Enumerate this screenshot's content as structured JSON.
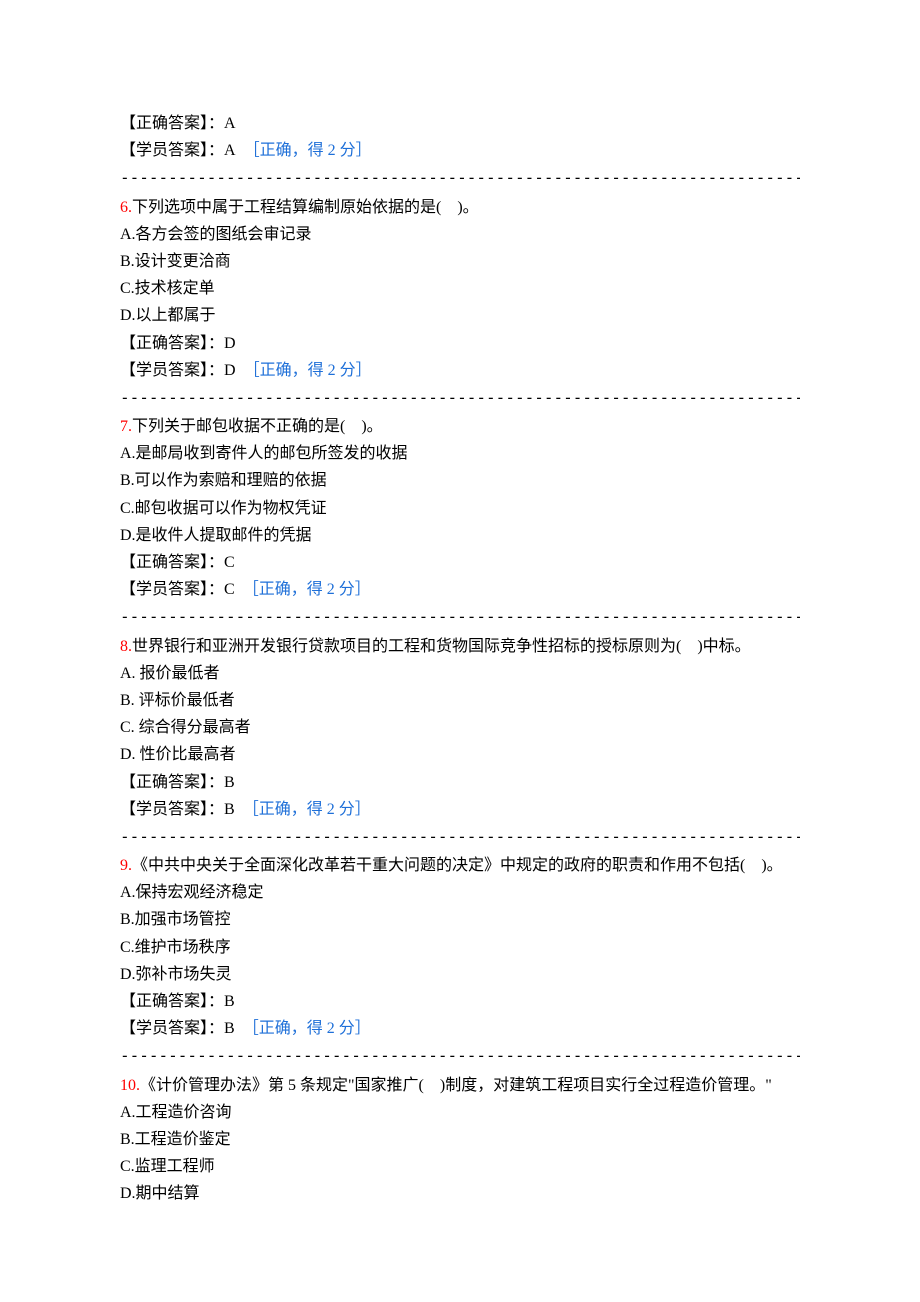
{
  "divider": "------------------------------------------------------------------------",
  "labels": {
    "correct_answer": "【正确答案】：",
    "student_answer": "【学员答案】：",
    "feedback_correct": "［正确，得 2 分］"
  },
  "partial_q5": {
    "correct_answer": "A",
    "student_answer": "A"
  },
  "questions": [
    {
      "number": "6.",
      "stem": "下列选项中属于工程结算编制原始依据的是(　)。",
      "options": [
        "A.各方会签的图纸会审记录",
        "B.设计变更洽商",
        "C.技术核定单",
        "D.以上都属于"
      ],
      "correct_answer": "D",
      "student_answer": "D",
      "show_feedback": true
    },
    {
      "number": "7.",
      "stem": "下列关于邮包收据不正确的是(　)。",
      "options": [
        "A.是邮局收到寄件人的邮包所签发的收据",
        "B.可以作为索赔和理赔的依据",
        "C.邮包收据可以作为物权凭证",
        "D.是收件人提取邮件的凭据"
      ],
      "correct_answer": "C",
      "student_answer": "C",
      "show_feedback": true
    },
    {
      "number": "8.",
      "stem": "世界银行和亚洲开发银行贷款项目的工程和货物国际竞争性招标的授标原则为(　)中标。",
      "options": [
        "A. 报价最低者",
        "B. 评标价最低者",
        "C. 综合得分最高者",
        "D. 性价比最高者"
      ],
      "correct_answer": "B",
      "student_answer": "B",
      "show_feedback": true
    },
    {
      "number": "9.",
      "stem": "《中共中央关于全面深化改革若干重大问题的决定》中规定的政府的职责和作用不包括(　)。",
      "options": [
        "A.保持宏观经济稳定",
        "B.加强市场管控",
        "C.维护市场秩序",
        "D.弥补市场失灵"
      ],
      "correct_answer": "B",
      "student_answer": "B",
      "show_feedback": true
    },
    {
      "number": "10.",
      "stem": "《计价管理办法》第 5 条规定\"国家推广(　)制度，对建筑工程项目实行全过程造价管理。\"",
      "options": [
        "A.工程造价咨询",
        "B.工程造价鉴定",
        "C.监理工程师",
        "D.期中结算"
      ],
      "correct_answer": null,
      "student_answer": null,
      "show_feedback": false
    }
  ]
}
